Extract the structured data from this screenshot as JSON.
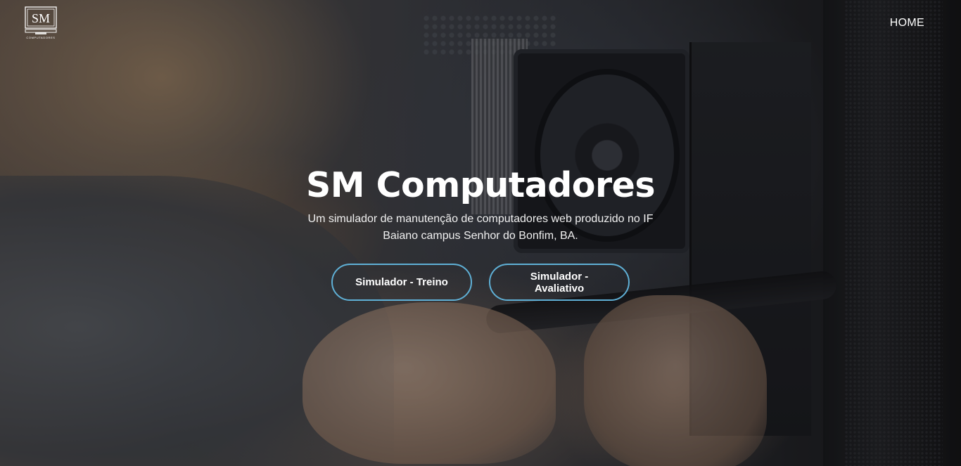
{
  "nav": {
    "logo_text": "SM",
    "logo_subtext": "COMPUTADORES",
    "home_label": "HOME"
  },
  "hero": {
    "title": "SM Computadores",
    "subtitle": "Um simulador de manutenção de computadores web produzido no IF Baiano campus Senhor do Bonfim, BA.",
    "buttons": [
      {
        "label": "Simulador - Treino"
      },
      {
        "label": "Simulador - Avaliativo"
      }
    ],
    "button_border_color": "#5fb0d6"
  }
}
